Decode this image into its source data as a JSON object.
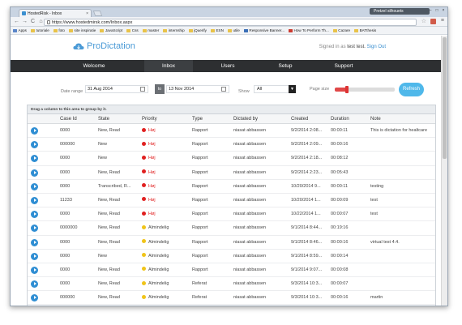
{
  "browser": {
    "tab_title": "HostedRisk - Inbox",
    "tab_close": "×",
    "user_chip": "Pretzel silhouets",
    "url": "https://www.hostedmirsk.com/Inbox.aspx",
    "back": "←",
    "forward": "→",
    "reload": "C",
    "home": "⌂",
    "star": "☆",
    "menu": "≡",
    "win_controls": [
      "–",
      "□",
      "×"
    ]
  },
  "bookmarks": [
    "Apps",
    "tutoriale",
    "foto",
    "site inspiratie",
    "JavaScript",
    "Css",
    "master",
    "internship",
    "jQuerify",
    "ESN",
    "utile",
    "Responsive Banner...",
    "How To Perform Th...",
    "Cazare",
    "BATthesis"
  ],
  "app": {
    "brand": "ProDictation",
    "signed_in_prefix": "Signed in as",
    "user": "test test.",
    "sign_out": "Sign Out",
    "nav": [
      "Welcome",
      "Inbox",
      "Users",
      "Setup",
      "Support"
    ]
  },
  "filter": {
    "date_range_label": "Date range",
    "date_from": "31 Aug 2014",
    "to_label": "to",
    "date_to": "13 Nov 2014",
    "show_label": "Show",
    "show_value": "All",
    "page_size_label": "Page size",
    "page_size_fraction": 0.2,
    "refresh": "Refresh"
  },
  "grid": {
    "group_hint": "Drag a column to this area to group by it.",
    "columns": [
      "Case Id",
      "State",
      "Priority",
      "Type",
      "Dictated by",
      "Created",
      "Duration",
      "Note"
    ],
    "rows": [
      {
        "case": "0000",
        "state": "New, Read",
        "priority": "Høj",
        "pcolor": "#e02020",
        "type": "Rapport",
        "by": "niasat abbassen",
        "created": "9/2/2014 2:08...",
        "duration": "00:00:11",
        "note": "This is dictation for healtcare"
      },
      {
        "case": "000000",
        "state": "New",
        "priority": "Høj",
        "pcolor": "#e02020",
        "type": "Rapport",
        "by": "niasat abbassen",
        "created": "9/2/2014 2:09...",
        "duration": "00:00:16",
        "note": ""
      },
      {
        "case": "0000",
        "state": "New",
        "priority": "Høj",
        "pcolor": "#e02020",
        "type": "Rapport",
        "by": "niasat abbassen",
        "created": "9/2/2014 2:18...",
        "duration": "00:08:12",
        "note": ""
      },
      {
        "case": "0000",
        "state": "New, Read",
        "priority": "Høj",
        "pcolor": "#e02020",
        "type": "Rapport",
        "by": "niasat abbassen",
        "created": "9/2/2014 2:23...",
        "duration": "00:05:43",
        "note": ""
      },
      {
        "case": "0000",
        "state": "Transcribed, R...",
        "priority": "Høj",
        "pcolor": "#e02020",
        "type": "Rapport",
        "by": "niasat abbassen",
        "created": "10/20/2014 9...",
        "duration": "00:00:11",
        "note": "testing"
      },
      {
        "case": "11233",
        "state": "New, Read",
        "priority": "Høj",
        "pcolor": "#e02020",
        "type": "Rapport",
        "by": "niasat abbassen",
        "created": "10/20/2014 1...",
        "duration": "00:00:09",
        "note": "test"
      },
      {
        "case": "0000",
        "state": "New, Read",
        "priority": "Høj",
        "pcolor": "#e02020",
        "type": "Rapport",
        "by": "niasat abbassen",
        "created": "10/22/2014 1...",
        "duration": "00:00:07",
        "note": "test"
      },
      {
        "case": "0000000",
        "state": "New, Read",
        "priority": "Almindelig",
        "pcolor": "#f0c419",
        "type": "Rapport",
        "by": "niasat abbassen",
        "created": "9/1/2014 8:44...",
        "duration": "00:19:16",
        "note": ""
      },
      {
        "case": "0000",
        "state": "New, Read",
        "priority": "Almindelig",
        "pcolor": "#f0c419",
        "type": "Rapport",
        "by": "niasat abbassen",
        "created": "9/1/2014 8:46...",
        "duration": "00:00:16",
        "note": "virtual test 4.4."
      },
      {
        "case": "0000",
        "state": "New",
        "priority": "Almindelig",
        "pcolor": "#f0c419",
        "type": "Rapport",
        "by": "niasat abbassen",
        "created": "9/1/2014 8:59...",
        "duration": "00:00:14",
        "note": ""
      },
      {
        "case": "0000",
        "state": "New, Read",
        "priority": "Almindelig",
        "pcolor": "#f0c419",
        "type": "Rapport",
        "by": "niasat abbassen",
        "created": "9/1/2014 9:07...",
        "duration": "00:00:08",
        "note": ""
      },
      {
        "case": "0000",
        "state": "New, Read",
        "priority": "Almindelig",
        "pcolor": "#f0c419",
        "type": "Referat",
        "by": "niasat abbassen",
        "created": "9/3/2014 10:3...",
        "duration": "00:00:07",
        "note": ""
      },
      {
        "case": "000000",
        "state": "New, Read",
        "priority": "Almindelig",
        "pcolor": "#f0c419",
        "type": "Referat",
        "by": "niasat abbassen",
        "created": "9/3/2014 10:3...",
        "duration": "00:00:16",
        "note": "martin"
      }
    ]
  }
}
